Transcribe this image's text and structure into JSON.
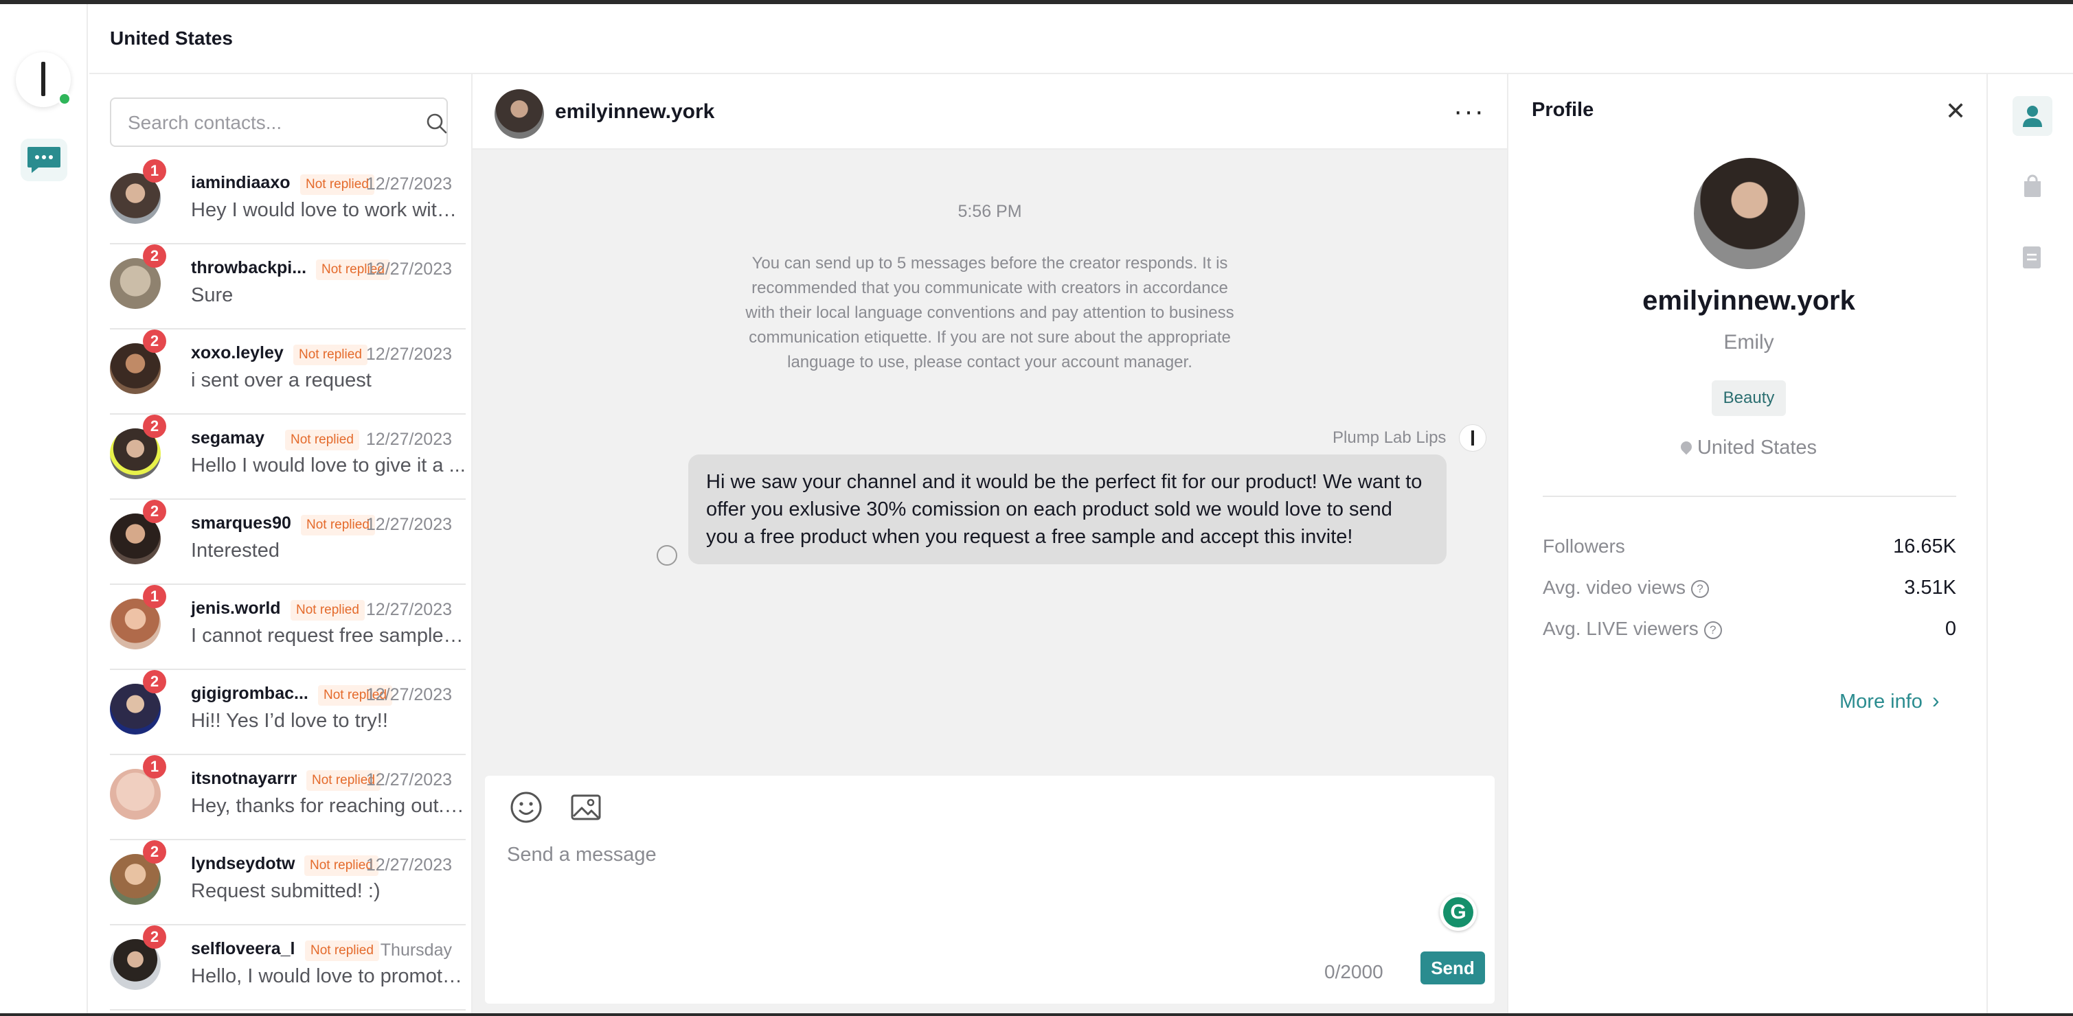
{
  "header": {
    "title": "United States"
  },
  "search": {
    "placeholder": "Search contacts..."
  },
  "contacts": [
    {
      "username": "iamindiaaxo",
      "status": "Not replied",
      "date": "12/27/2023",
      "preview": "Hey I would love to work with ...",
      "unread": "1"
    },
    {
      "username": "throwbackpi...",
      "status": "Not replied",
      "date": "12/27/2023",
      "preview": "Sure",
      "unread": "2"
    },
    {
      "username": "xoxo.leyley",
      "status": "Not replied",
      "date": "12/27/2023",
      "preview": "i sent over a request",
      "unread": "2"
    },
    {
      "username": "segamay",
      "status": "Not replied",
      "date": "12/27/2023",
      "preview": "Hello I would love to give it a ...",
      "unread": "2"
    },
    {
      "username": "smarques90",
      "status": "Not replied",
      "date": "12/27/2023",
      "preview": "Interested",
      "unread": "2"
    },
    {
      "username": "jenis.world",
      "status": "Not replied",
      "date": "12/27/2023",
      "preview": "I cannot request free samples...",
      "unread": "1"
    },
    {
      "username": "gigigrombac...",
      "status": "Not replied",
      "date": "12/27/2023",
      "preview": "Hi!! Yes I’d love to try!!",
      "unread": "2"
    },
    {
      "username": "itsnotnayarrr",
      "status": "Not replied",
      "date": "12/27/2023",
      "preview": "Hey, thanks for reaching out. ...",
      "unread": "1"
    },
    {
      "username": "lyndseydotw",
      "status": "Not replied",
      "date": "12/27/2023",
      "preview": "Request submitted! :)",
      "unread": "2"
    },
    {
      "username": "selfloveera_l",
      "status": "Not replied",
      "date": "Thursday",
      "preview": "Hello, I would love to promote...",
      "unread": "2"
    }
  ],
  "chat": {
    "username": "emilyinnew.york",
    "time": "5:56 PM",
    "system_note": "You can send up to 5 messages before the creator responds. It is recommended that you communicate with creators in accordance with their local language conventions and pay attention to business communication etiquette. If you are not sure about the appropriate language to use, please contact your account manager.",
    "sender": "Plump Lab Lips",
    "message": "Hi we saw your channel and it would be the perfect fit for our product! We want to offer you exlusive 30% comission on each product sold we would love to send you a free product when you request a free sample and accept this invite!",
    "input_placeholder": "Send a message",
    "char_count": "0/2000",
    "send_label": "Send",
    "grammarly_letter": "G"
  },
  "profile": {
    "title": "Profile",
    "username": "emilyinnew.york",
    "display_name": "Emily",
    "category": "Beauty",
    "location": "United States",
    "stats": [
      {
        "label": "Followers",
        "value": "16.65K",
        "help": false
      },
      {
        "label": "Avg. video views",
        "value": "3.51K",
        "help": true
      },
      {
        "label": "Avg. LIVE viewers",
        "value": "0",
        "help": true
      }
    ],
    "more_info": "More info"
  },
  "colors": {
    "accent": "#2a8c8f",
    "unread_badge": "#e5484d",
    "not_replied_text": "#e46a2b",
    "not_replied_bg": "#fff1e8",
    "online": "#2fb55a"
  },
  "icons": {
    "search": "search-icon",
    "emoji": "emoji-icon",
    "image": "image-icon",
    "close": "close-icon",
    "more": "more-icon",
    "chat": "chat-icon",
    "profile_tool": "person-icon",
    "shop_tool": "shopping-bag-icon",
    "notes_tool": "document-icon"
  }
}
